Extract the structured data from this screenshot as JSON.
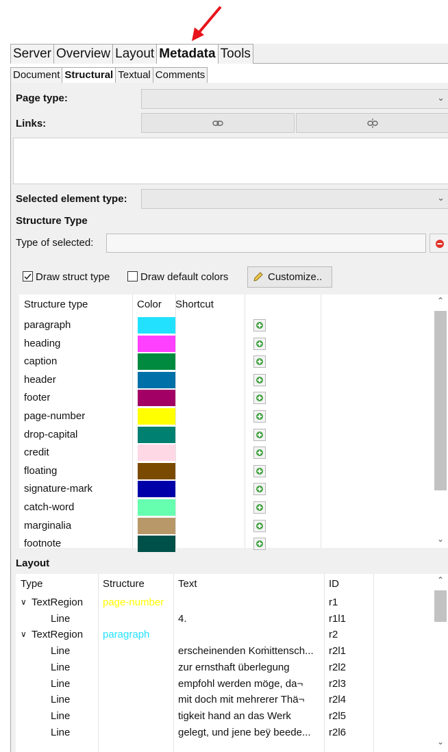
{
  "main_tabs": [
    "Server",
    "Overview",
    "Layout",
    "Metadata",
    "Tools"
  ],
  "sub_tabs": [
    "Document",
    "Structural",
    "Textual",
    "Comments"
  ],
  "page_type_label": "Page type:",
  "links_label": "Links:",
  "selected_element_type_label": "Selected element type:",
  "structure_type_heading": "Structure Type",
  "type_of_selected_label": "Type of selected:",
  "draw_struct_type_label": "Draw struct type",
  "draw_default_colors_label": "Draw default colors",
  "customize_label": "Customize..",
  "checkboxes": {
    "draw_struct_type": true,
    "draw_default_colors": false
  },
  "struct_table": {
    "headers": [
      "Structure type",
      "Color",
      "Shortcut"
    ],
    "rows": [
      {
        "name": "paragraph",
        "color": "#22e1ff"
      },
      {
        "name": "heading",
        "color": "#ff40ff"
      },
      {
        "name": "caption",
        "color": "#008a40"
      },
      {
        "name": "header",
        "color": "#0070a8"
      },
      {
        "name": "footer",
        "color": "#a30066"
      },
      {
        "name": "page-number",
        "color": "#ffff00"
      },
      {
        "name": "drop-capital",
        "color": "#008070"
      },
      {
        "name": "credit",
        "color": "#ffd8e6"
      },
      {
        "name": "floating",
        "color": "#7a4a00"
      },
      {
        "name": "signature-mark",
        "color": "#0000a8"
      },
      {
        "name": "catch-word",
        "color": "#66ffb0"
      },
      {
        "name": "marginalia",
        "color": "#b89868"
      },
      {
        "name": "footnote",
        "color": "#00504a"
      }
    ]
  },
  "layout_heading": "Layout",
  "layout_table": {
    "headers": [
      "Type",
      "Structure",
      "Text",
      "ID"
    ],
    "rows": [
      {
        "type": "TextRegion",
        "expand": true,
        "structure": "page-number",
        "structure_color": "#ffff00",
        "text": "",
        "id": "r1"
      },
      {
        "type": "Line",
        "expand": false,
        "structure": "",
        "text": "4.",
        "id": "r1l1"
      },
      {
        "type": "TextRegion",
        "expand": true,
        "structure": "paragraph",
        "structure_color": "#22e1ff",
        "text": "",
        "id": "r2"
      },
      {
        "type": "Line",
        "expand": false,
        "structure": "",
        "text": "erscheinenden Koṁittensch...",
        "id": "r2l1"
      },
      {
        "type": "Line",
        "expand": false,
        "structure": "",
        "text": "zur ernsthaft überlegung",
        "id": "r2l2"
      },
      {
        "type": "Line",
        "expand": false,
        "structure": "",
        "text": "empfohl werden möge, da¬",
        "id": "r2l3"
      },
      {
        "type": "Line",
        "expand": false,
        "structure": "",
        "text": "mit doch mit mehrerer Thä¬",
        "id": "r2l4"
      },
      {
        "type": "Line",
        "expand": false,
        "structure": "",
        "text": "tigkeit hand an das Werk",
        "id": "r2l5"
      },
      {
        "type": "Line",
        "expand": false,
        "structure": "",
        "text": "gelegt, und jene beÿ beede...",
        "id": "r2l6"
      }
    ]
  },
  "icons": {
    "link": "link-icon",
    "unlink": "unlink-icon",
    "remove": "remove-icon",
    "pencil": "pencil-icon",
    "add": "add-shortcut-icon"
  },
  "colors": {
    "arrow": "#e8131b",
    "selection_plus": "#47a447",
    "remove_red": "#e0352b"
  }
}
